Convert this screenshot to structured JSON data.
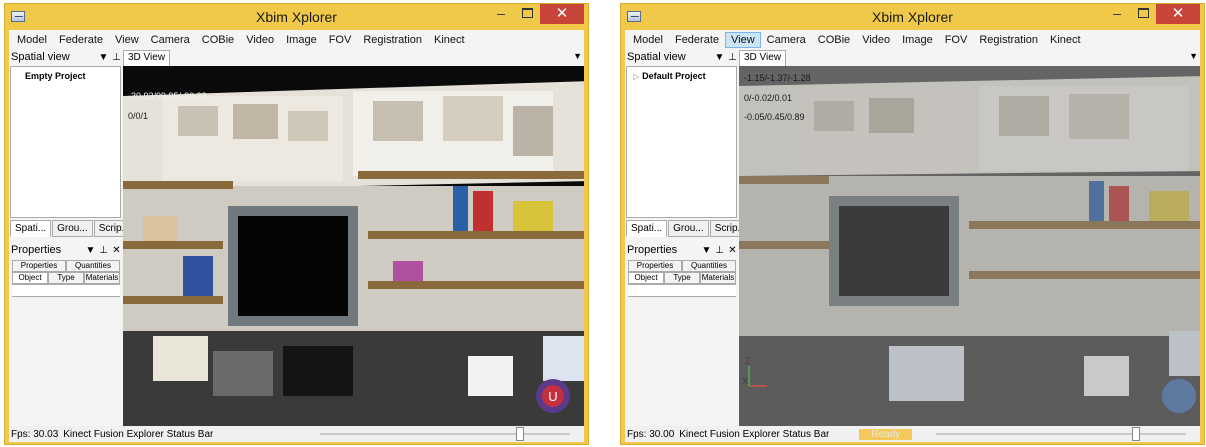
{
  "windows": [
    {
      "title": "Xbim Xplorer",
      "menu": [
        "Model",
        "Federate",
        "View",
        "Camera",
        "COBie",
        "Video",
        "Image",
        "FOV",
        "Registration",
        "Kinect"
      ],
      "active_menu": "",
      "spatial_view": {
        "title": "Spatial view",
        "pin_icon": "pin-icon",
        "dropdown_icon": "dropdown-arrow-icon",
        "root_item": "Empty Project"
      },
      "left_tabs": [
        "Spati...",
        "Grou...",
        "Scrip..."
      ],
      "properties": {
        "title": "Properties",
        "tabs_row1": [
          "Properties",
          "Quantities"
        ],
        "tabs_row2": [
          "Object",
          "Type",
          "Materials"
        ]
      },
      "view_tab": "3D View",
      "overlay": [
        "-30.93/99.95/-30.38",
        "0/0/1"
      ],
      "status": {
        "fps": "Fps: 30.03",
        "message": "Kinect Fusion Explorer Status Bar",
        "ready": ""
      }
    },
    {
      "title": "Xbim Xplorer",
      "menu": [
        "Model",
        "Federate",
        "View",
        "Camera",
        "COBie",
        "Video",
        "Image",
        "FOV",
        "Registration",
        "Kinect"
      ],
      "active_menu": "View",
      "spatial_view": {
        "title": "Spatial view",
        "pin_icon": "pin-icon",
        "dropdown_icon": "dropdown-arrow-icon",
        "root_item": "Default Project"
      },
      "left_tabs": [
        "Spati...",
        "Grou...",
        "Scrip..."
      ],
      "properties": {
        "title": "Properties",
        "tabs_row1": [
          "Properties",
          "Quantities"
        ],
        "tabs_row2": [
          "Object",
          "Type",
          "Materials"
        ]
      },
      "view_tab": "3D View",
      "overlay": [
        "-1.15/-1.37/-1.28",
        "0/-0.02/0.01",
        "-0.05/0.45/0.89"
      ],
      "status": {
        "fps": "Fps: 30.00",
        "message": "Kinect Fusion Explorer Status Bar",
        "ready": "Ready"
      }
    }
  ],
  "colors": {
    "title_bar": "#f0c94a",
    "close_button": "#c7453a",
    "menu_active": "#cde6f7"
  },
  "icons": {
    "minimize": "minimize-icon",
    "maximize": "maximize-icon",
    "close": "close-icon",
    "app": "xbim-app-icon"
  }
}
